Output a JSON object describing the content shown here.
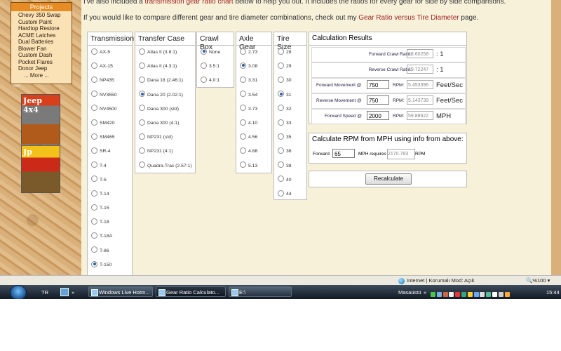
{
  "intro": {
    "line1_pre": "I've also included a ",
    "line1_link": "transmission gear ratio chart",
    "line1_post": " below to help you out. It includes the ratios for every gear for side by side comparisons.",
    "line2_pre": "If you would like to compare different gear and tire diameter combinations, check out my ",
    "line2_link": "Gear Ratio versus Tire Diameter",
    "line2_post": " page."
  },
  "sidebar": {
    "title": "Projects",
    "items": [
      "Chevy 350 Swap",
      "Custom Paint",
      "Hardtop Restore",
      "ACME Latches",
      "Dual Batteries",
      "Blower Fan",
      "Custom Dash",
      "Pocket Flares",
      "Donor Jeep",
      "... More ..."
    ],
    "mag1": "Jeep 4x4",
    "mag2": "Jp"
  },
  "transmission": {
    "header": "Transmission",
    "options": [
      "AX-5",
      "AX-15",
      "NP435",
      "NV3550",
      "NV4500",
      "SM420",
      "SM465",
      "SR-4",
      "T-4",
      "T-5",
      "T-14",
      "T-15",
      "T-18",
      "T-18A",
      "T-86",
      "T-150"
    ],
    "selected": "T-150"
  },
  "transfer_case": {
    "header": "Transfer Case",
    "options": [
      "Atlas II (3.8:1)",
      "Atlas II (4.3:1)",
      "Dana 18 (2.46:1)",
      "Dana 20 (2.02:1)",
      "Dana 300 (std)",
      "Dana 300 (4:1)",
      "NP231 (std)",
      "NP231 (4:1)",
      "Quadra-Trac (2.57:1)"
    ],
    "selected": "Dana 20 (2.02:1)"
  },
  "crawl_box": {
    "header": "Crawl Box",
    "options": [
      "None",
      "3.5:1",
      "4.0:1"
    ],
    "selected": "None"
  },
  "axle_gear": {
    "header": "Axle Gear",
    "options": [
      "2.73",
      "3.08",
      "3.31",
      "3.54",
      "3.73",
      "4.10",
      "4.56",
      "4.88",
      "5.13"
    ],
    "selected": "3.08"
  },
  "tire_size": {
    "header": "Tire Size",
    "options": [
      "28",
      "29",
      "30",
      "31",
      "32",
      "33",
      "35",
      "36",
      "38",
      "40",
      "44"
    ],
    "selected": "31"
  },
  "results": {
    "header": "Calculation Results",
    "forward_crawl_label": "Forward Crawl Ratio:",
    "forward_crawl_value": "18.60258",
    "forward_crawl_unit": ": 1",
    "reverse_crawl_label": "Reverse Crawl Ratio:",
    "reverse_crawl_value": "19.72247",
    "reverse_crawl_unit": ": 1",
    "forward_movement_label": "Forward Movement @",
    "forward_movement_rpm": "750",
    "forward_movement_rpm_label": "RPM:",
    "forward_movement_value": "5.453396",
    "forward_movement_unit": "Feet/Sec",
    "reverse_movement_label": "Reverse Movement @",
    "reverse_movement_rpm": "750",
    "reverse_movement_rpm_label": "RPM:",
    "reverse_movement_value": "5.143739",
    "reverse_movement_unit": "Feet/Sec",
    "forward_speed_label": "Forward Speed @",
    "forward_speed_rpm": "2000",
    "forward_speed_rpm_label": "RPM:",
    "forward_speed_value": "59.88622",
    "forward_speed_unit": "MPH"
  },
  "rpm_calc": {
    "header": "Calculate RPM from MPH using info from above:",
    "forward_label": "Forward",
    "mph_value": "65",
    "mph_requires_label": "MPH requires",
    "rpm_value": "2170.783",
    "rpm_unit": "RPM"
  },
  "recalculate_label": "Recalculate",
  "statusbar": {
    "security": "Internet | Korumalı Mod: Açık",
    "zoom": "%100"
  },
  "taskbar": {
    "lang": "TR",
    "windows": [
      "Windows Live Hotm...",
      "Gear Ratio Calculato...",
      "E:\\"
    ],
    "desktop": "Masaüstü",
    "clock": "15:44"
  },
  "colors": {
    "link": "#9b1f1f",
    "radio_selected": "#2b5ea8",
    "sidebar_header": "#e78c22"
  }
}
